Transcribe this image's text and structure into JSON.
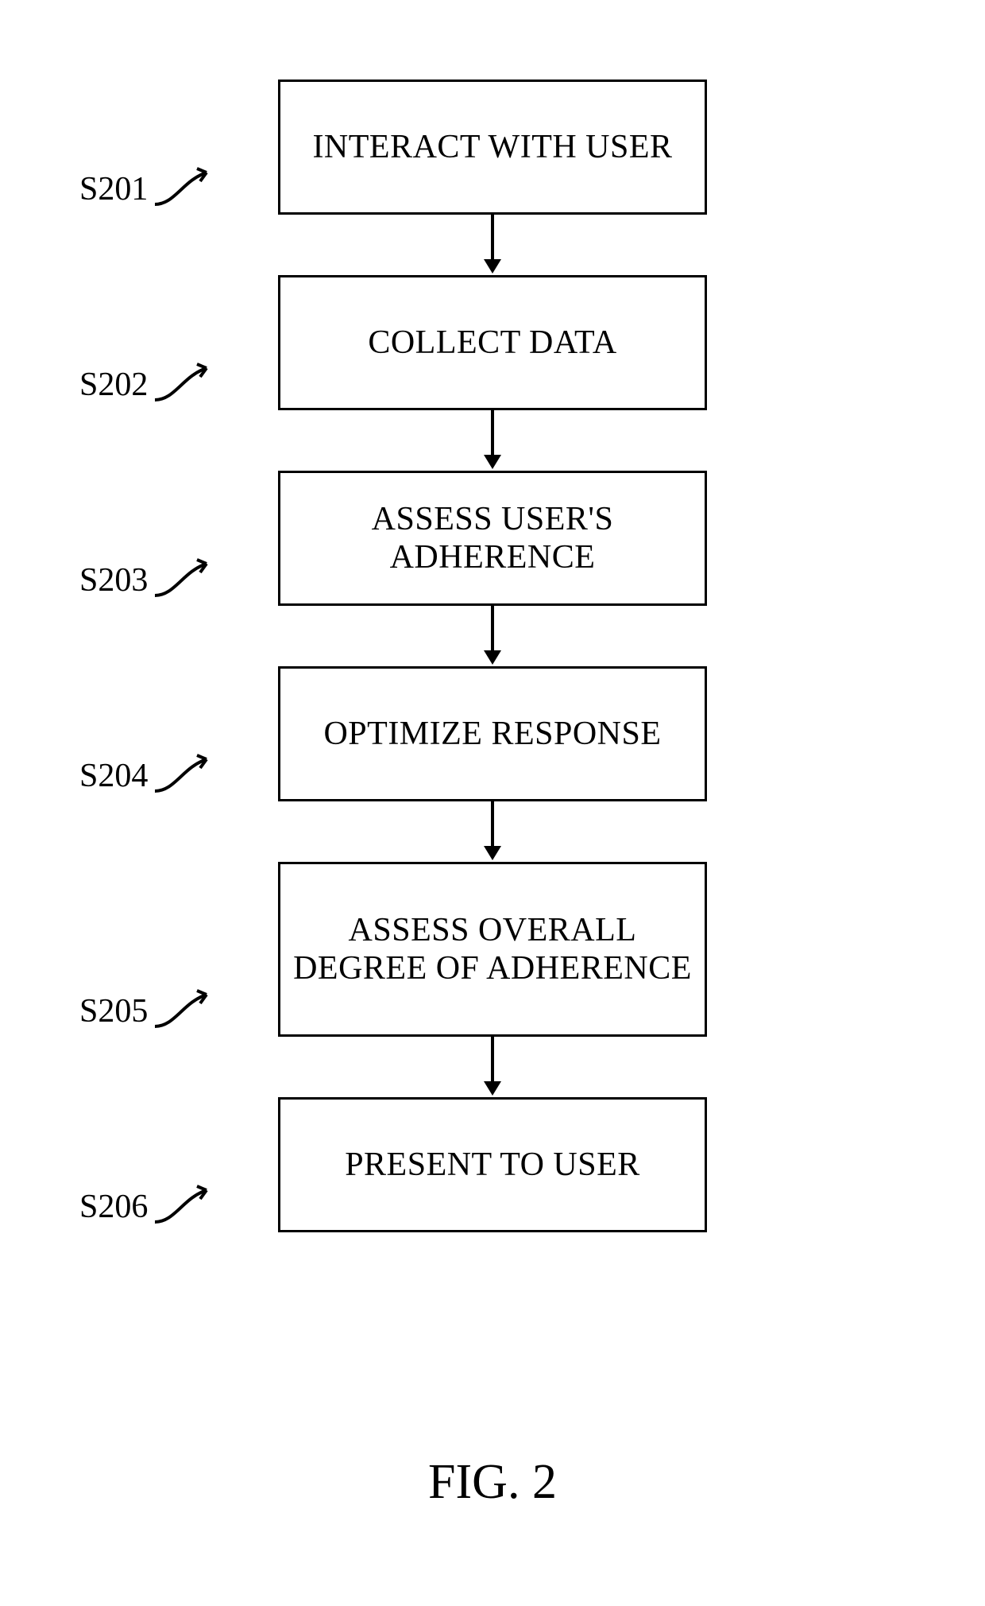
{
  "figure_label": "FIG. 2",
  "steps": [
    {
      "id": "S201",
      "text": "INTERACT WITH USER",
      "lines": 2
    },
    {
      "id": "S202",
      "text": "COLLECT DATA",
      "lines": 1,
      "tall": true
    },
    {
      "id": "S203",
      "text": "ASSESS USER'S ADHERENCE",
      "lines": 2
    },
    {
      "id": "S204",
      "text": "OPTIMIZE RESPONSE",
      "lines": 1,
      "tall": true
    },
    {
      "id": "S205",
      "text": "ASSESS OVERALL DEGREE OF ADHERENCE",
      "lines": 3
    },
    {
      "id": "S206",
      "text": "PRESENT TO USER",
      "lines": 1,
      "tall": true
    }
  ]
}
